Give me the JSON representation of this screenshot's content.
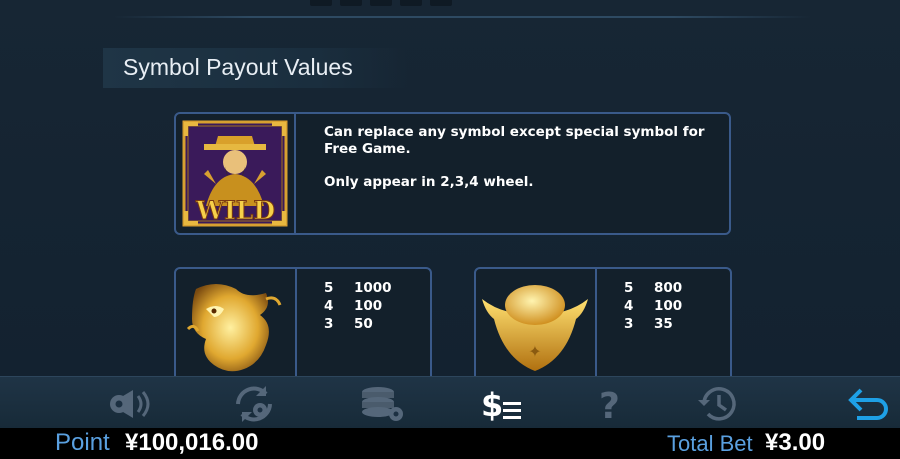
{
  "section": {
    "title": "Symbol Payout Values"
  },
  "wild": {
    "icon": "wild-god-of-wealth-icon",
    "badge": "WILD",
    "description_line1": "Can replace any symbol except special symbol for Free Game.",
    "description_line2": "Only appear in 2,3,4 wheel."
  },
  "symbols": [
    {
      "icon": "golden-dragon-icon",
      "payouts": [
        {
          "count": "5",
          "value": "1000"
        },
        {
          "count": "4",
          "value": "100"
        },
        {
          "count": "3",
          "value": "50"
        }
      ]
    },
    {
      "icon": "gold-ingot-icon",
      "payouts": [
        {
          "count": "5",
          "value": "800"
        },
        {
          "count": "4",
          "value": "100"
        },
        {
          "count": "3",
          "value": "35"
        }
      ]
    }
  ],
  "toolbar": {
    "buttons": [
      "sound-settings-icon",
      "autoplay-icon",
      "bet-chips-icon",
      "paytable-icon",
      "help-icon",
      "history-icon",
      "back-icon"
    ]
  },
  "status": {
    "point_label": "Point",
    "point_value": "¥100,016.00",
    "bet_label": "Total Bet",
    "bet_value": "¥3.00"
  },
  "colors": {
    "accent_blue": "#5aa0e0",
    "card_border": "#3a5a8a",
    "gold": "#e0b040",
    "active_icon": "#ffffff",
    "inactive_icon": "#55677a",
    "back_icon": "#1ea0e6"
  }
}
